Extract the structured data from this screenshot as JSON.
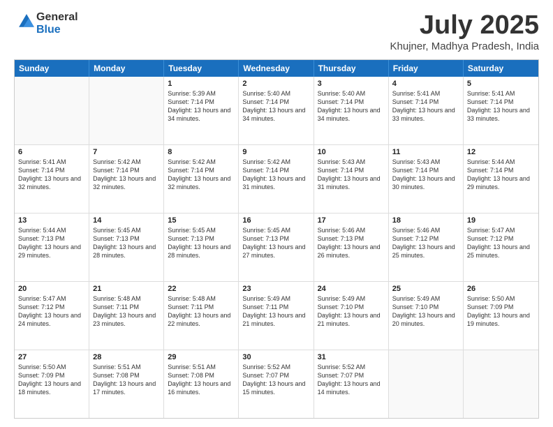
{
  "header": {
    "logo_general": "General",
    "logo_blue": "Blue",
    "title": "July 2025",
    "location": "Khujner, Madhya Pradesh, India"
  },
  "days_of_week": [
    "Sunday",
    "Monday",
    "Tuesday",
    "Wednesday",
    "Thursday",
    "Friday",
    "Saturday"
  ],
  "weeks": [
    [
      {
        "day": "",
        "info": ""
      },
      {
        "day": "",
        "info": ""
      },
      {
        "day": "1",
        "info": "Sunrise: 5:39 AM\nSunset: 7:14 PM\nDaylight: 13 hours and 34 minutes."
      },
      {
        "day": "2",
        "info": "Sunrise: 5:40 AM\nSunset: 7:14 PM\nDaylight: 13 hours and 34 minutes."
      },
      {
        "day": "3",
        "info": "Sunrise: 5:40 AM\nSunset: 7:14 PM\nDaylight: 13 hours and 34 minutes."
      },
      {
        "day": "4",
        "info": "Sunrise: 5:41 AM\nSunset: 7:14 PM\nDaylight: 13 hours and 33 minutes."
      },
      {
        "day": "5",
        "info": "Sunrise: 5:41 AM\nSunset: 7:14 PM\nDaylight: 13 hours and 33 minutes."
      }
    ],
    [
      {
        "day": "6",
        "info": "Sunrise: 5:41 AM\nSunset: 7:14 PM\nDaylight: 13 hours and 32 minutes."
      },
      {
        "day": "7",
        "info": "Sunrise: 5:42 AM\nSunset: 7:14 PM\nDaylight: 13 hours and 32 minutes."
      },
      {
        "day": "8",
        "info": "Sunrise: 5:42 AM\nSunset: 7:14 PM\nDaylight: 13 hours and 32 minutes."
      },
      {
        "day": "9",
        "info": "Sunrise: 5:42 AM\nSunset: 7:14 PM\nDaylight: 13 hours and 31 minutes."
      },
      {
        "day": "10",
        "info": "Sunrise: 5:43 AM\nSunset: 7:14 PM\nDaylight: 13 hours and 31 minutes."
      },
      {
        "day": "11",
        "info": "Sunrise: 5:43 AM\nSunset: 7:14 PM\nDaylight: 13 hours and 30 minutes."
      },
      {
        "day": "12",
        "info": "Sunrise: 5:44 AM\nSunset: 7:14 PM\nDaylight: 13 hours and 29 minutes."
      }
    ],
    [
      {
        "day": "13",
        "info": "Sunrise: 5:44 AM\nSunset: 7:13 PM\nDaylight: 13 hours and 29 minutes."
      },
      {
        "day": "14",
        "info": "Sunrise: 5:45 AM\nSunset: 7:13 PM\nDaylight: 13 hours and 28 minutes."
      },
      {
        "day": "15",
        "info": "Sunrise: 5:45 AM\nSunset: 7:13 PM\nDaylight: 13 hours and 28 minutes."
      },
      {
        "day": "16",
        "info": "Sunrise: 5:45 AM\nSunset: 7:13 PM\nDaylight: 13 hours and 27 minutes."
      },
      {
        "day": "17",
        "info": "Sunrise: 5:46 AM\nSunset: 7:13 PM\nDaylight: 13 hours and 26 minutes."
      },
      {
        "day": "18",
        "info": "Sunrise: 5:46 AM\nSunset: 7:12 PM\nDaylight: 13 hours and 25 minutes."
      },
      {
        "day": "19",
        "info": "Sunrise: 5:47 AM\nSunset: 7:12 PM\nDaylight: 13 hours and 25 minutes."
      }
    ],
    [
      {
        "day": "20",
        "info": "Sunrise: 5:47 AM\nSunset: 7:12 PM\nDaylight: 13 hours and 24 minutes."
      },
      {
        "day": "21",
        "info": "Sunrise: 5:48 AM\nSunset: 7:11 PM\nDaylight: 13 hours and 23 minutes."
      },
      {
        "day": "22",
        "info": "Sunrise: 5:48 AM\nSunset: 7:11 PM\nDaylight: 13 hours and 22 minutes."
      },
      {
        "day": "23",
        "info": "Sunrise: 5:49 AM\nSunset: 7:11 PM\nDaylight: 13 hours and 21 minutes."
      },
      {
        "day": "24",
        "info": "Sunrise: 5:49 AM\nSunset: 7:10 PM\nDaylight: 13 hours and 21 minutes."
      },
      {
        "day": "25",
        "info": "Sunrise: 5:49 AM\nSunset: 7:10 PM\nDaylight: 13 hours and 20 minutes."
      },
      {
        "day": "26",
        "info": "Sunrise: 5:50 AM\nSunset: 7:09 PM\nDaylight: 13 hours and 19 minutes."
      }
    ],
    [
      {
        "day": "27",
        "info": "Sunrise: 5:50 AM\nSunset: 7:09 PM\nDaylight: 13 hours and 18 minutes."
      },
      {
        "day": "28",
        "info": "Sunrise: 5:51 AM\nSunset: 7:08 PM\nDaylight: 13 hours and 17 minutes."
      },
      {
        "day": "29",
        "info": "Sunrise: 5:51 AM\nSunset: 7:08 PM\nDaylight: 13 hours and 16 minutes."
      },
      {
        "day": "30",
        "info": "Sunrise: 5:52 AM\nSunset: 7:07 PM\nDaylight: 13 hours and 15 minutes."
      },
      {
        "day": "31",
        "info": "Sunrise: 5:52 AM\nSunset: 7:07 PM\nDaylight: 13 hours and 14 minutes."
      },
      {
        "day": "",
        "info": ""
      },
      {
        "day": "",
        "info": ""
      }
    ]
  ]
}
